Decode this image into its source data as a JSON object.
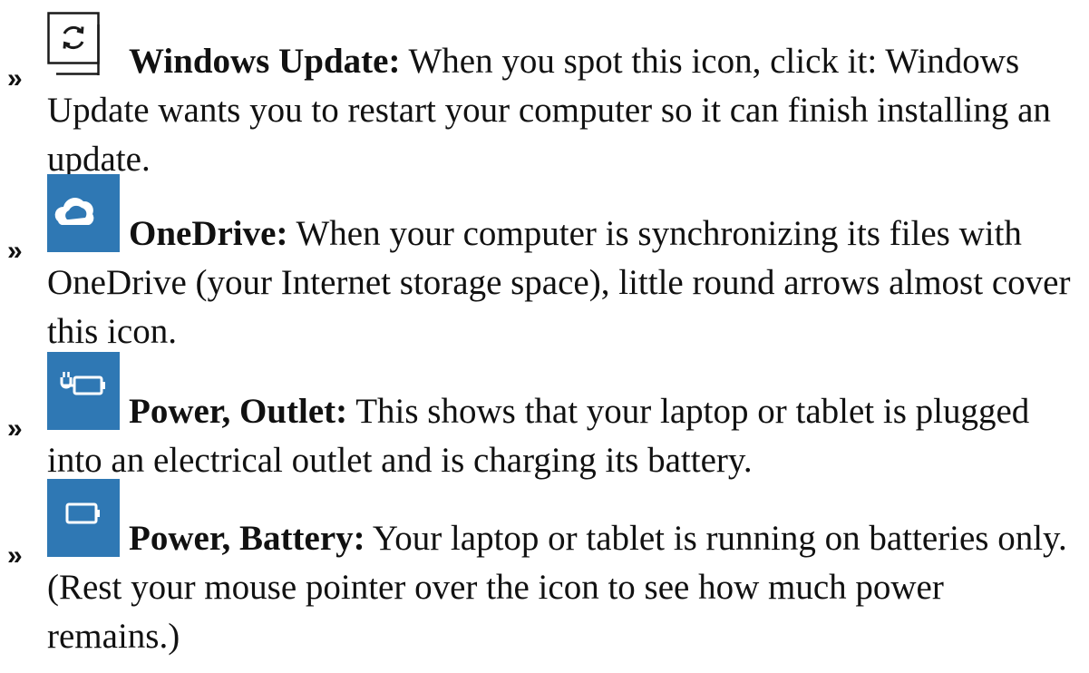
{
  "items": [
    {
      "icon": "windows-update-icon",
      "label": "Windows Update:",
      "text": " When you spot this icon, click it: Windows Update wants you to restart your computer so it can finish installing an update."
    },
    {
      "icon": "onedrive-icon",
      "label": "OneDrive:",
      "text": " When your computer is synchronizing its files with OneDrive (your Internet storage space), little round arrows almost cover this icon."
    },
    {
      "icon": "power-outlet-icon",
      "label": "Power, Outlet:",
      "text": " This shows that your laptop or tablet is plugged into an electrical outlet and is charging its battery."
    },
    {
      "icon": "power-battery-icon",
      "label": "Power, Battery:",
      "text": " Your laptop or tablet is running on batteries only. (Rest your mouse pointer over the icon to see how much power remains.)"
    }
  ],
  "bullet_glyph": "»",
  "colors": {
    "icon_blue": "#2f78b4",
    "icon_border": "#1a1a1a",
    "text": "#111111"
  }
}
